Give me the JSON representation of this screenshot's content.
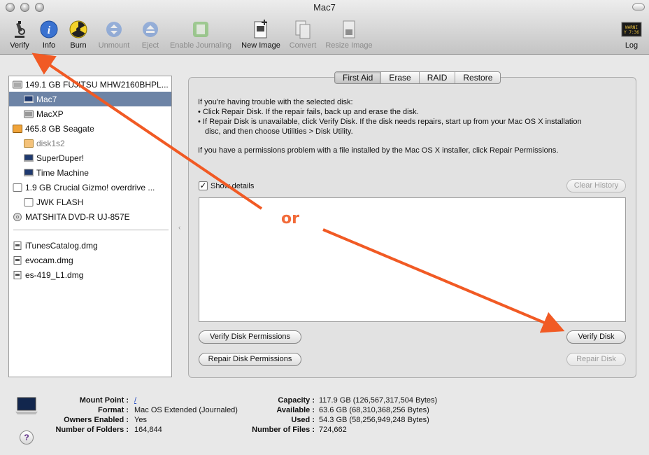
{
  "window": {
    "title": "Mac7"
  },
  "toolbar": {
    "verify": "Verify",
    "info": "Info",
    "burn": "Burn",
    "unmount": "Unmount",
    "eject": "Eject",
    "enable_journaling": "Enable Journaling",
    "new_image": "New Image",
    "convert": "Convert",
    "resize_image": "Resize Image",
    "log": "Log"
  },
  "sidebar": {
    "items": [
      {
        "label": "149.1 GB FUJITSU MHW2160BHPL..."
      },
      {
        "label": "Mac7"
      },
      {
        "label": "MacXP"
      },
      {
        "label": "465.8 GB Seagate"
      },
      {
        "label": "disk1s2"
      },
      {
        "label": "SuperDuper!"
      },
      {
        "label": "Time Machine"
      },
      {
        "label": "1.9 GB Crucial Gizmo! overdrive ..."
      },
      {
        "label": "JWK FLASH"
      },
      {
        "label": "MATSHITA DVD-R UJ-857E"
      },
      {
        "label": "iTunesCatalog.dmg"
      },
      {
        "label": "evocam.dmg"
      },
      {
        "label": "es-419_L1.dmg"
      }
    ]
  },
  "tabs": {
    "first_aid": "First Aid",
    "erase": "Erase",
    "raid": "RAID",
    "restore": "Restore"
  },
  "first_aid": {
    "line1": "If you're having trouble with the selected disk:",
    "line2": "• Click Repair Disk. If the repair fails, back up and erase the disk.",
    "line3": "• If Repair Disk is unavailable, click Verify Disk. If the disk needs repairs, start up from your Mac OS X installation",
    "line4": "disc, and then choose Utilities > Disk Utility.",
    "line5": "If you have a permissions problem with a file installed by the Mac OS X installer, click Repair Permissions.",
    "show_details": "Show details",
    "clear_history": "Clear History",
    "verify_permissions": "Verify Disk Permissions",
    "repair_permissions": "Repair Disk Permissions",
    "verify_disk": "Verify Disk",
    "repair_disk": "Repair Disk"
  },
  "annotation": {
    "or": "or",
    "color": "#f15a24"
  },
  "disk_info": {
    "mount_point_label": "Mount Point :",
    "mount_point": "/",
    "format_label": "Format :",
    "format": "Mac OS Extended (Journaled)",
    "owners_label": "Owners Enabled :",
    "owners": "Yes",
    "folders_label": "Number of Folders :",
    "folders": "164,844",
    "capacity_label": "Capacity :",
    "capacity": "117.9 GB (126,567,317,504 Bytes)",
    "available_label": "Available :",
    "available": "63.6 GB (68,310,368,256 Bytes)",
    "used_label": "Used :",
    "used": "54.3 GB (58,256,949,248 Bytes)",
    "files_label": "Number of Files :",
    "files": "724,662"
  },
  "help": "?"
}
